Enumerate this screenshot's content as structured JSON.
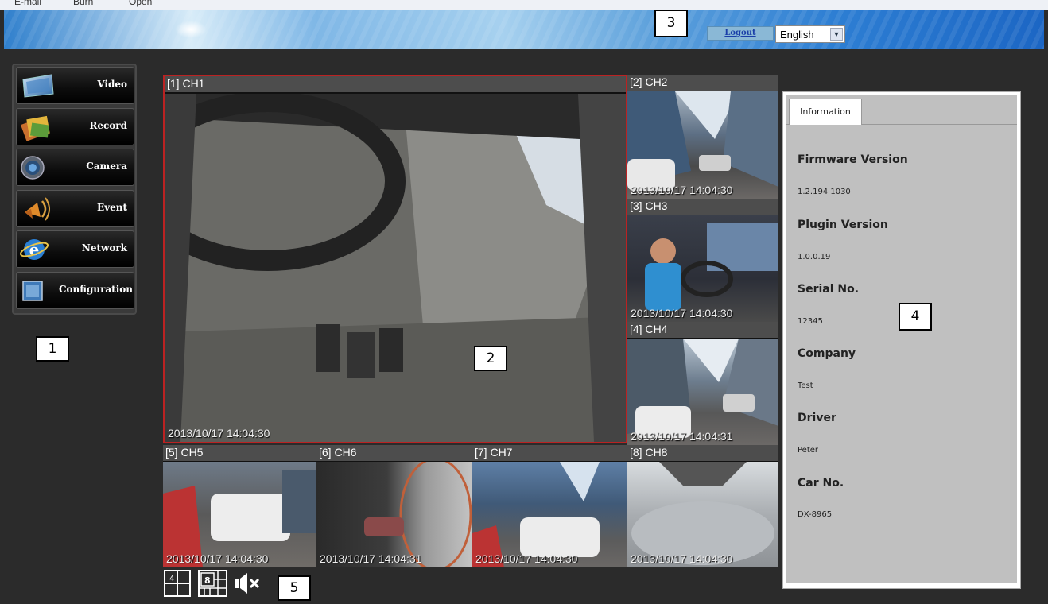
{
  "menubar": {
    "items": [
      "E-mail",
      "Burn",
      "Open"
    ]
  },
  "header": {
    "logout_label": "Logout",
    "language": {
      "selected": "English",
      "options": [
        "English"
      ]
    }
  },
  "callouts": [
    "1",
    "2",
    "3",
    "4",
    "5"
  ],
  "nav": {
    "items": [
      {
        "label": "Video",
        "icon": "video-icon"
      },
      {
        "label": "Record",
        "icon": "record-icon"
      },
      {
        "label": "Camera",
        "icon": "camera-icon"
      },
      {
        "label": "Event",
        "icon": "event-icon"
      },
      {
        "label": "Network",
        "icon": "network-icon"
      },
      {
        "label": "Configuration",
        "icon": "configuration-icon"
      }
    ]
  },
  "channels": [
    {
      "title": "[1] CH1",
      "timestamp": "2013/10/17 14:04:30"
    },
    {
      "title": "[2] CH2",
      "timestamp": "2013/10/17 14:04:30"
    },
    {
      "title": "[3] CH3",
      "timestamp": "2013/10/17 14:04:30"
    },
    {
      "title": "[4] CH4",
      "timestamp": "2013/10/17 14:04:31"
    },
    {
      "title": "[5] CH5",
      "timestamp": "2013/10/17 14:04:30"
    },
    {
      "title": "[6] CH6",
      "timestamp": "2013/10/17 14:04:31"
    },
    {
      "title": "[7] CH7",
      "timestamp": "2013/10/17 14:04:30"
    },
    {
      "title": "[8] CH8",
      "timestamp": "2013/10/17 14:04:30"
    }
  ],
  "info": {
    "tab": "Information",
    "fields": [
      {
        "label": "Firmware Version",
        "value": "1.2.194 1030"
      },
      {
        "label": "Plugin Version",
        "value": "1.0.0.19"
      },
      {
        "label": "Serial No.",
        "value": "12345"
      },
      {
        "label": "Company",
        "value": "Test"
      },
      {
        "label": "Driver",
        "value": "Peter"
      },
      {
        "label": "Car No.",
        "value": "DX-8965"
      }
    ]
  },
  "toolbar": {
    "layout4_label": "4",
    "layout8_label": "8"
  }
}
